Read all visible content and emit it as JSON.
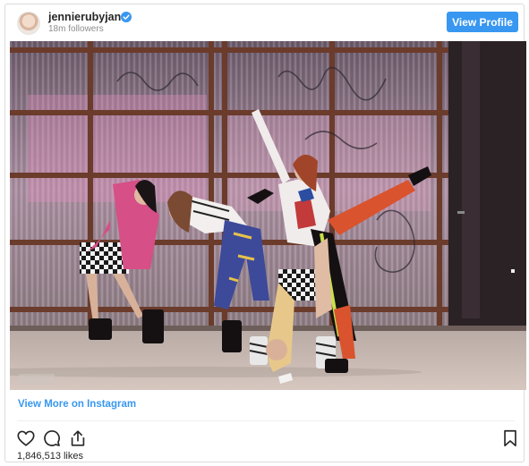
{
  "header": {
    "username": "jennierubyjane",
    "followers": "18m followers",
    "view_profile_label": "View Profile",
    "verified_color": "#3897f0"
  },
  "footer": {
    "view_more_label": "View More on Instagram",
    "likes": "1,846,513 likes"
  },
  "icons": {
    "like": "heart-icon",
    "comment": "comment-icon",
    "share": "share-icon",
    "save": "bookmark-icon"
  },
  "colors": {
    "accent": "#3897f0",
    "muted": "#8e8e8e",
    "border": "#dbdbdb"
  }
}
